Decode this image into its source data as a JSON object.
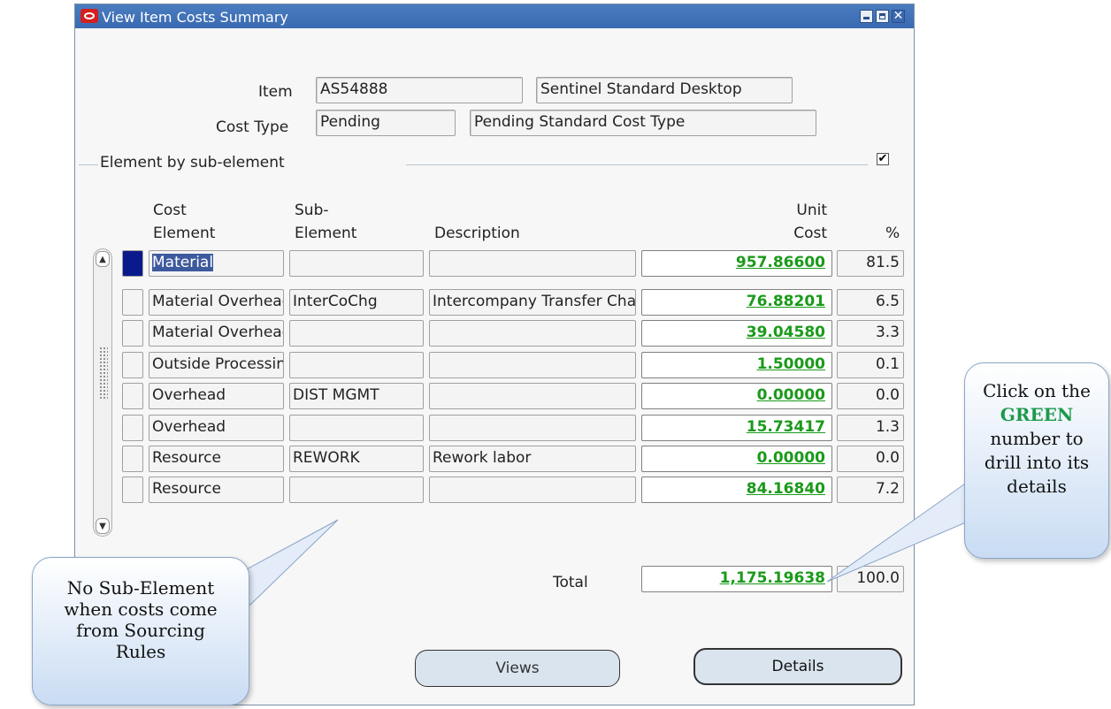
{
  "window": {
    "title": "View Item Costs Summary",
    "close_glyph": "✕"
  },
  "header": {
    "item_label": "Item",
    "item_value": "AS54888",
    "item_description": "Sentinel Standard Desktop",
    "cost_type_label": "Cost Type",
    "cost_type_value": "Pending",
    "cost_type_description": "Pending Standard Cost Type"
  },
  "group": {
    "label": "Element by sub-element",
    "checked": true,
    "check_glyph": "✔"
  },
  "columns": {
    "cost_element": [
      "Cost",
      "Element"
    ],
    "sub_element": [
      "Sub-",
      "Element"
    ],
    "description": "Description",
    "unit_cost": [
      "Unit",
      "Cost"
    ],
    "percent": "%"
  },
  "rows": [
    {
      "cost_element": "Material",
      "sub_element": "",
      "description": "",
      "unit_cost": "957.86600",
      "percent": "81.5"
    },
    {
      "cost_element": "Material Overhead",
      "sub_element": "InterCoChg",
      "description": "Intercompany Transfer Charge",
      "unit_cost": "76.88201",
      "percent": "6.5"
    },
    {
      "cost_element": "Material Overhead",
      "sub_element": "",
      "description": "",
      "unit_cost": "39.04580",
      "percent": "3.3"
    },
    {
      "cost_element": "Outside Processing",
      "sub_element": "",
      "description": "",
      "unit_cost": "1.50000",
      "percent": "0.1"
    },
    {
      "cost_element": "Overhead",
      "sub_element": "DIST MGMT",
      "description": "",
      "unit_cost": "0.00000",
      "percent": "0.0"
    },
    {
      "cost_element": "Overhead",
      "sub_element": "",
      "description": "",
      "unit_cost": "15.73417",
      "percent": "1.3"
    },
    {
      "cost_element": "Resource",
      "sub_element": "REWORK",
      "description": "Rework labor",
      "unit_cost": "0.00000",
      "percent": "0.0"
    },
    {
      "cost_element": "Resource",
      "sub_element": "",
      "description": "",
      "unit_cost": "84.16840",
      "percent": "7.2"
    }
  ],
  "total": {
    "label": "Total",
    "unit_cost": "1,175.19638",
    "percent": "100.0"
  },
  "buttons": {
    "views": "Views",
    "details": "Details"
  },
  "callouts": {
    "no_sub_element": "No Sub-Element when costs come from Sourcing Rules",
    "click_prefix": "Click on the",
    "click_green": "GREEN",
    "click_suffix": "number to drill into its details"
  },
  "colors": {
    "cost_link": "#1a9a1a",
    "title_bar": "#3a6ab0",
    "current_record": "#0a1a8c"
  }
}
